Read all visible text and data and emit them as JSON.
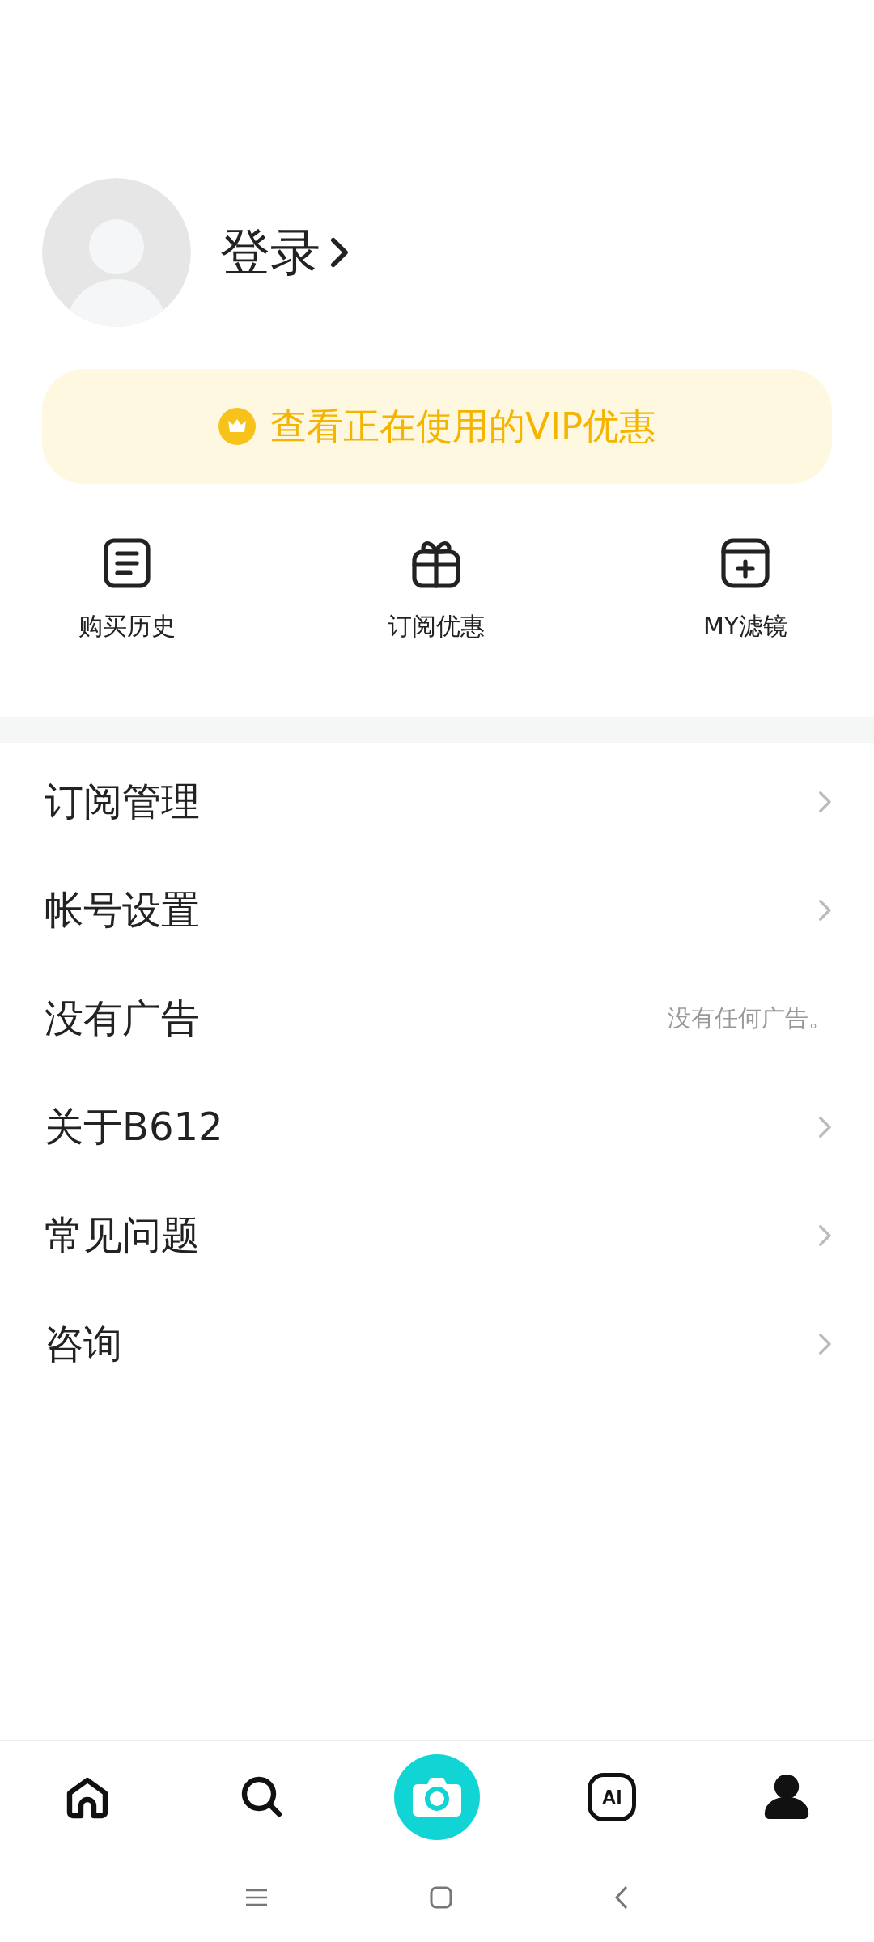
{
  "profile": {
    "login_label": "登录"
  },
  "vip_banner": {
    "text": "查看正在使用的VIP优惠"
  },
  "shortcuts": [
    {
      "kind": "receipt",
      "label": "购买历史"
    },
    {
      "kind": "gift",
      "label": "订阅优惠"
    },
    {
      "kind": "filter",
      "label": "MY滤镜"
    }
  ],
  "menu": [
    {
      "kind": "link",
      "label": "订阅管理"
    },
    {
      "kind": "link",
      "label": "帐号设置"
    },
    {
      "kind": "info",
      "label": "没有广告",
      "value": "没有任何广告。"
    },
    {
      "kind": "link",
      "label": "关于B612"
    },
    {
      "kind": "link",
      "label": "常见问题"
    },
    {
      "kind": "link",
      "label": "咨询"
    }
  ],
  "bottom_nav": [
    {
      "kind": "home",
      "selected": false
    },
    {
      "kind": "search",
      "selected": false
    },
    {
      "kind": "camera",
      "selected": false
    },
    {
      "kind": "ai",
      "text": "AI",
      "selected": false
    },
    {
      "kind": "profile",
      "selected": true
    }
  ]
}
